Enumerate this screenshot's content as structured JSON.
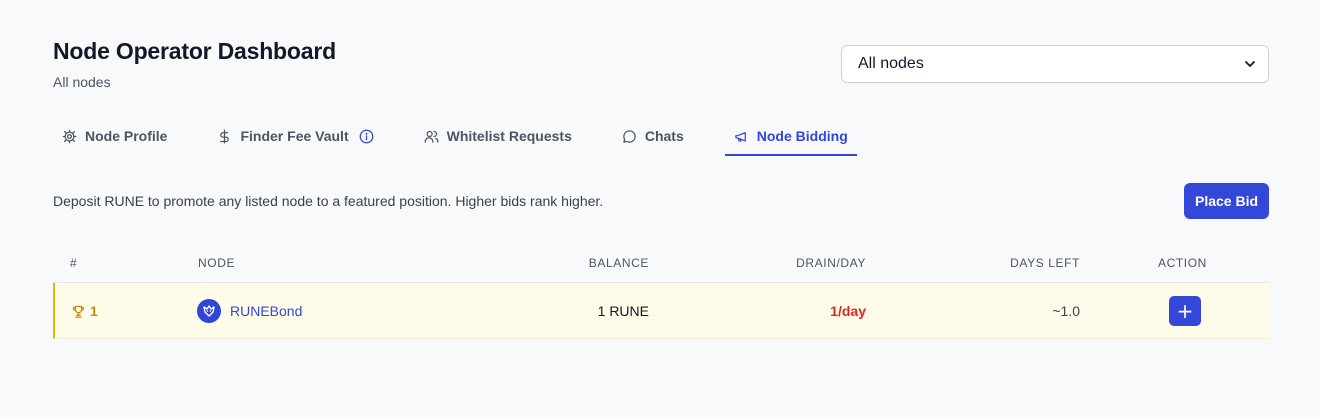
{
  "header": {
    "title": "Node Operator Dashboard",
    "subtitle": "All nodes"
  },
  "node_select": {
    "selected": "All nodes"
  },
  "tabs": [
    {
      "label": "Node Profile",
      "icon": "gear-icon",
      "active": false
    },
    {
      "label": "Finder Fee Vault",
      "icon": "dollar-icon",
      "active": false
    },
    {
      "label": "Whitelist Requests",
      "icon": "users-icon",
      "active": false
    },
    {
      "label": "Chats",
      "icon": "chat-bubble-icon",
      "active": false
    },
    {
      "label": "Node Bidding",
      "icon": "megaphone-icon",
      "active": true
    }
  ],
  "bidding": {
    "description": "Deposit RUNE to promote any listed node to a featured position. Higher bids rank higher.",
    "place_bid_label": "Place Bid"
  },
  "table": {
    "columns": [
      "#",
      "NODE",
      "BALANCE",
      "DRAIN/DAY",
      "DAYS LEFT",
      "ACTION"
    ],
    "rows": [
      {
        "rank": "1",
        "node": "RUNEBond",
        "balance": "1 RUNE",
        "drain": "1/day",
        "days_left": "~1.0",
        "action": "+"
      }
    ]
  },
  "colors": {
    "accent": "#3347d9",
    "highlight_row": "#fefce8",
    "rank_gold": "#ca8a04",
    "drain_red": "#dc2626"
  }
}
